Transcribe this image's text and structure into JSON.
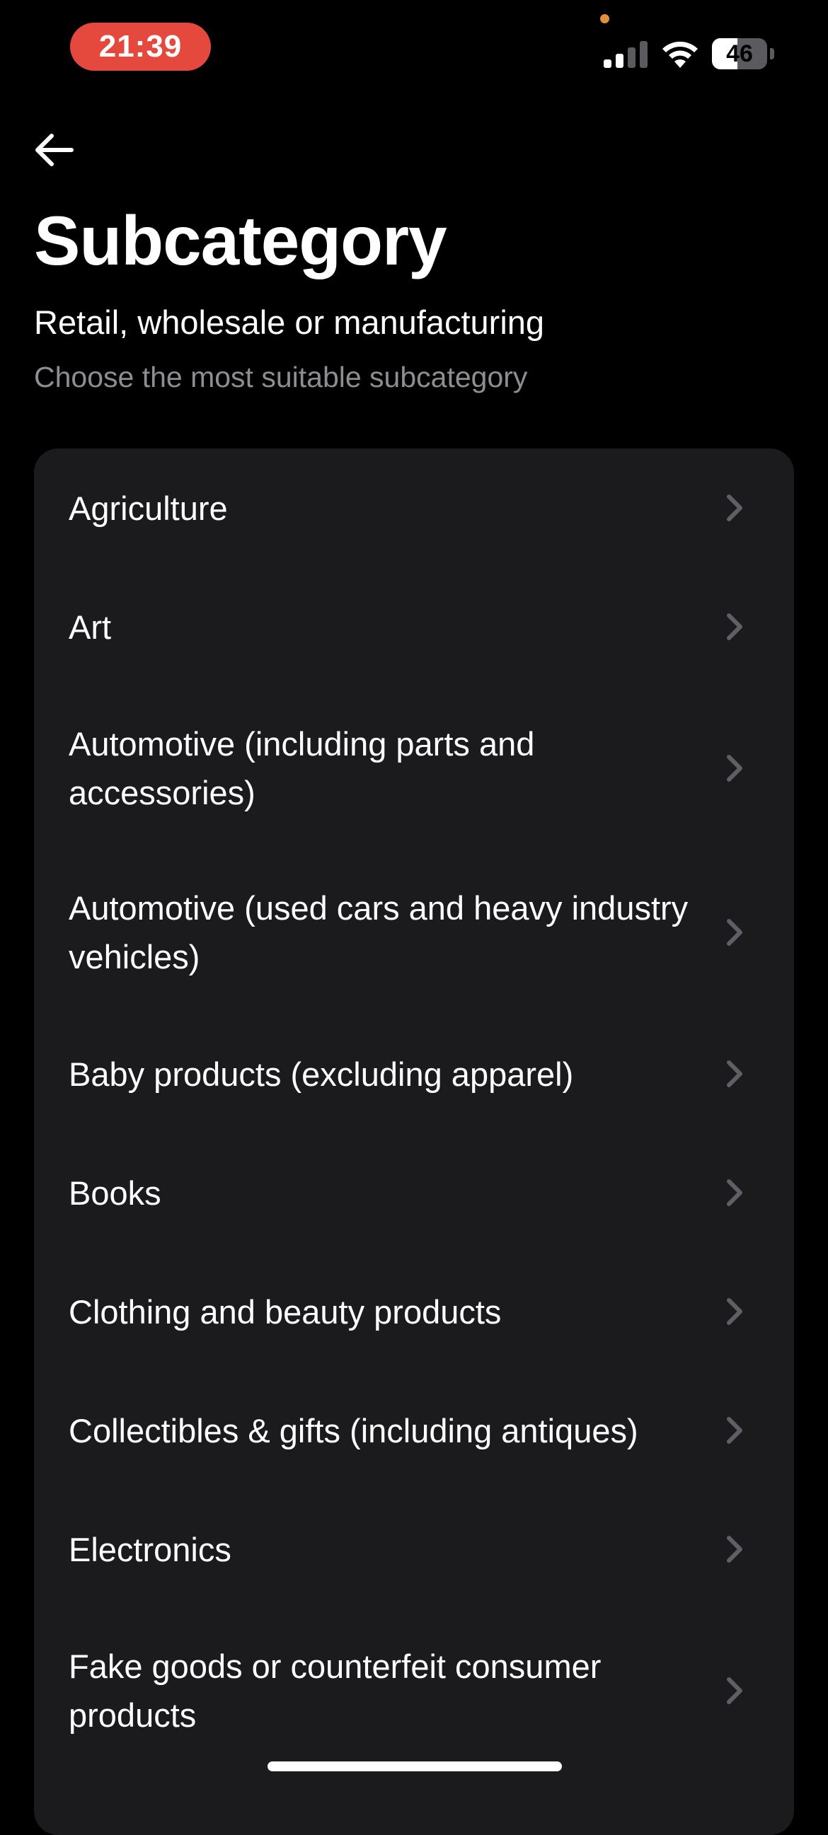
{
  "status_bar": {
    "time": "21:39",
    "battery_level": "46",
    "battery_fraction": 0.46,
    "signal_bars_active": 2,
    "signal_bars_total": 4
  },
  "header": {
    "back_icon": "arrow-left-icon",
    "title": "Subcategory",
    "category": "Retail, wholesale or manufacturing",
    "instruction": "Choose the most suitable subcategory"
  },
  "subcategories": [
    {
      "label": "Agriculture"
    },
    {
      "label": "Art"
    },
    {
      "label": "Automotive (including parts and accessories)"
    },
    {
      "label": "Automotive (used cars and heavy industry vehicles)"
    },
    {
      "label": "Baby products (excluding apparel)"
    },
    {
      "label": "Books"
    },
    {
      "label": "Clothing and beauty products"
    },
    {
      "label": "Collectibles & gifts (including antiques)"
    },
    {
      "label": "Electronics"
    },
    {
      "label": "Fake goods or counterfeit consumer products"
    }
  ],
  "colors": {
    "background": "#000000",
    "card": "#1b1b1e",
    "secondary_text": "#8d8d93",
    "chevron": "#5f5f65",
    "time_pill": "#e5483d"
  }
}
